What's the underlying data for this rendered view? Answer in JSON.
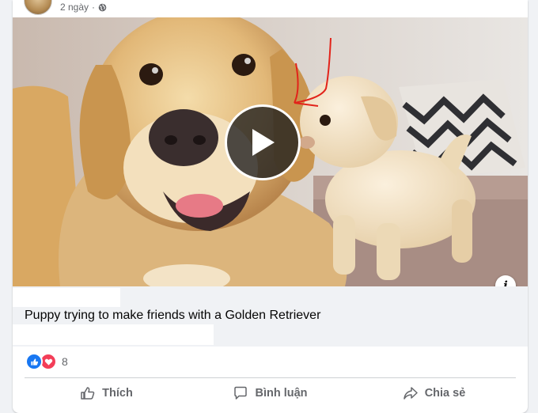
{
  "post": {
    "time": "2 ngày",
    "privacy_icon": "globe-icon"
  },
  "video": {
    "play_icon": "play-icon",
    "info_label": "i"
  },
  "link": {
    "title": "Puppy trying to make friends with a Golden Retriever"
  },
  "reactions": {
    "icons": [
      "like-icon",
      "love-icon"
    ],
    "count": "8"
  },
  "actions": {
    "like": "Thích",
    "comment": "Bình luận",
    "share": "Chia sẻ"
  },
  "colors": {
    "like_blue": "#1877f2",
    "love_red": "#f33e58",
    "secondary_text": "#65676b"
  }
}
